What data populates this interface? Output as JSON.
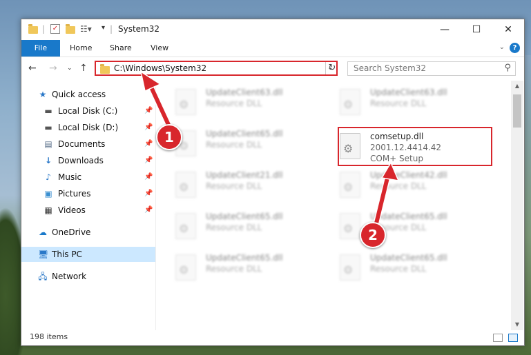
{
  "window": {
    "title": "System32",
    "controls": {
      "minimize": "—",
      "maximize": "☐",
      "close": "✕"
    }
  },
  "ribbon": {
    "tabs": [
      "File",
      "Home",
      "Share",
      "View"
    ],
    "help": "?"
  },
  "address": {
    "path": "C:\\Windows\\System32",
    "search_placeholder": "Search System32"
  },
  "sidebar": {
    "quick_access": "Quick access",
    "items": [
      {
        "label": "Local Disk (C:)",
        "icon": "drive-icon"
      },
      {
        "label": "Local Disk (D:)",
        "icon": "drive-icon"
      },
      {
        "label": "Documents",
        "icon": "documents-icon"
      },
      {
        "label": "Downloads",
        "icon": "downloads-icon"
      },
      {
        "label": "Music",
        "icon": "music-icon"
      },
      {
        "label": "Pictures",
        "icon": "pictures-icon"
      },
      {
        "label": "Videos",
        "icon": "videos-icon"
      }
    ],
    "onedrive": "OneDrive",
    "this_pc": "This PC",
    "network": "Network"
  },
  "files": {
    "left": [
      {
        "name": "UpdateClient63.dll",
        "type": "Resource DLL"
      },
      {
        "name": "UpdateClient65.dll",
        "type": "Resource DLL"
      },
      {
        "name": "UpdateClient21.dll",
        "type": "Resource DLL"
      },
      {
        "name": "UpdateClient65.dll",
        "type": "Resource DLL"
      },
      {
        "name": "UpdateClient65.dll",
        "type": "Resource DLL"
      }
    ],
    "right": [
      {
        "name": "UpdateClient63.dll",
        "type": "Resource DLL"
      },
      {
        "name": "UpdateClient42.dll",
        "type": "Resource DLL"
      },
      {
        "name": "UpdateClient65.dll",
        "type": "Resource DLL"
      },
      {
        "name": "UpdateClient65.dll",
        "type": "Resource DLL"
      }
    ],
    "highlighted": {
      "name": "comsetup.dll",
      "version": "2001.12.4414.42",
      "description": "COM+ Setup"
    }
  },
  "status": {
    "item_count": "198 items"
  },
  "annotations": {
    "step1": "1",
    "step2": "2",
    "color": "#d8262c"
  }
}
